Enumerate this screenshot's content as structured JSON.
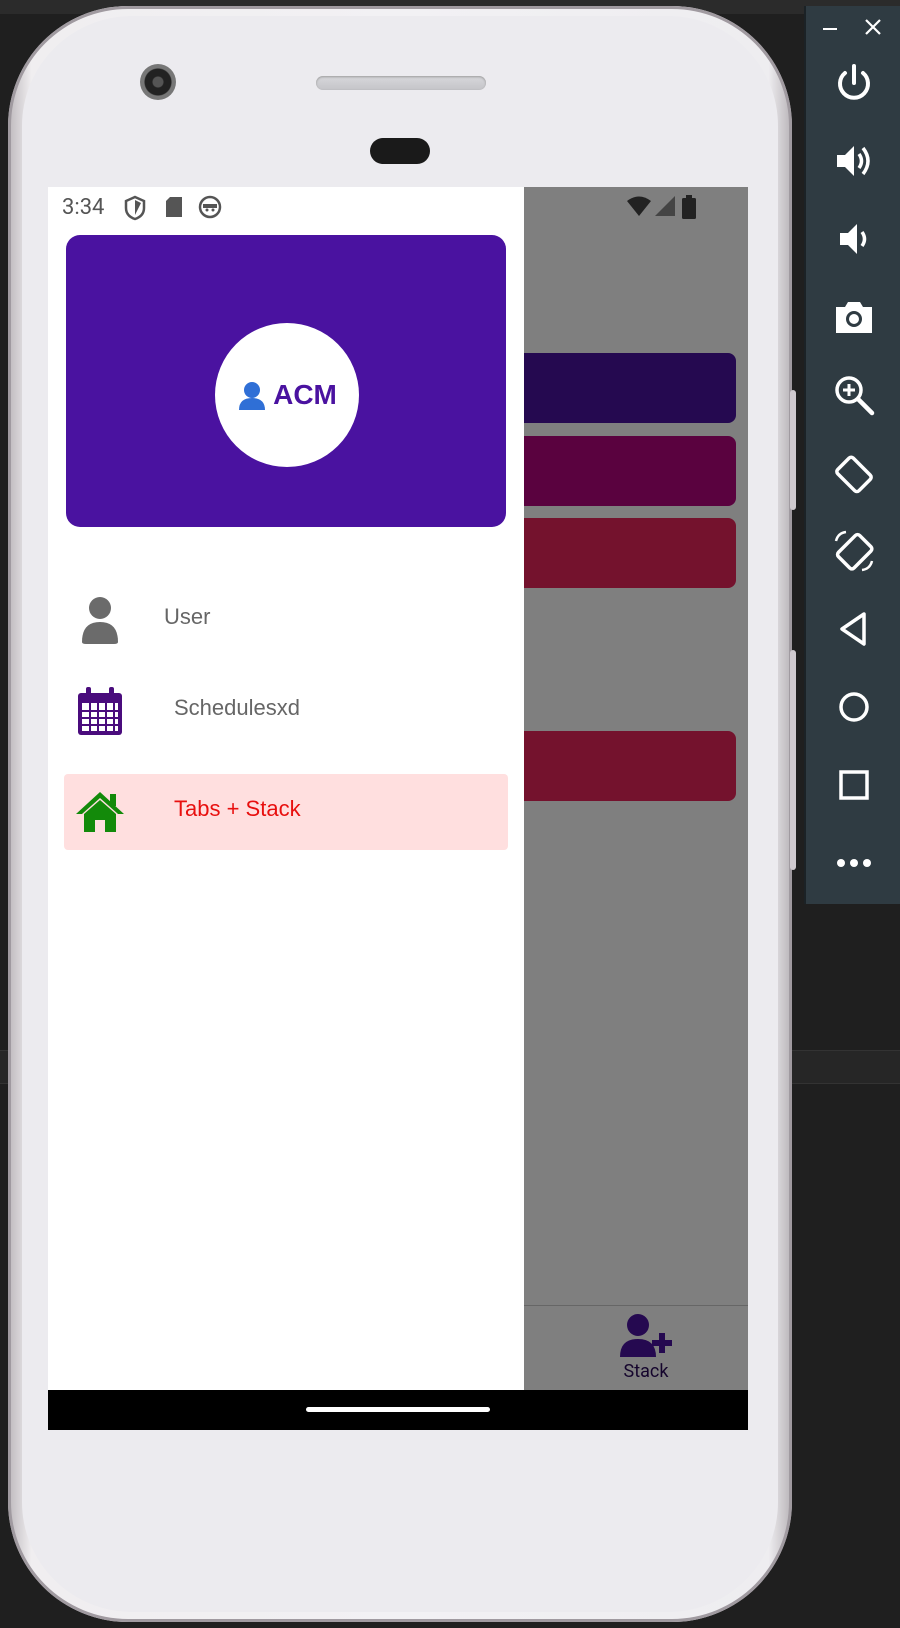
{
  "status_bar": {
    "time": "3:34",
    "left_icons": [
      "shield-icon",
      "sd-card-icon",
      "android-debug-icon"
    ],
    "right_icons": [
      "wifi-icon",
      "signal-icon",
      "battery-icon"
    ]
  },
  "drawer": {
    "header": {
      "avatar_text": "ACM",
      "avatar_icon": "person-emoji-icon",
      "color": "#4a12a0"
    },
    "items": [
      {
        "label": "User",
        "icon": "user-icon",
        "icon_color": "#6b6b6b",
        "active": false
      },
      {
        "label": "Schedulesxd",
        "icon": "calendar-icon",
        "icon_color": "#4a0c7d",
        "active": false
      },
      {
        "label": "Tabs + Stack",
        "icon": "home-icon",
        "icon_color": "#138a0a",
        "active": true,
        "active_text_color": "#e8100f",
        "active_bg": "#ffdfdf"
      }
    ]
  },
  "app_background": {
    "buttons_colors": [
      "#4a12a0",
      "#b5047f",
      "#e9245b",
      "#e9245b"
    ],
    "tab_bar": {
      "visible_tab_label": "Stack",
      "visible_tab_icon": "user-plus-icon"
    }
  },
  "emulator_controls": {
    "window_buttons": [
      "minimize-icon",
      "close-icon"
    ],
    "buttons": [
      "power-icon",
      "volume-up-icon",
      "volume-down-icon",
      "camera-icon",
      "zoom-icon",
      "rotate-left-icon",
      "rotate-right-icon",
      "back-icon",
      "home-circle-icon",
      "overview-icon",
      "more-icon"
    ]
  }
}
